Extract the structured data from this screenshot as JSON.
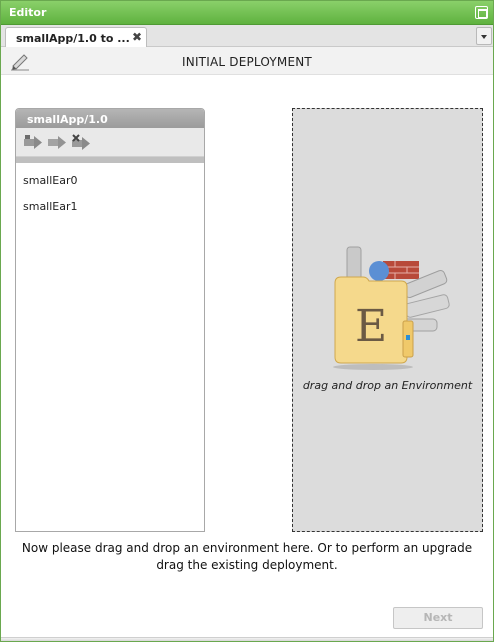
{
  "window": {
    "title": "Editor"
  },
  "tabs": [
    {
      "label": "smallApp/1.0 to ...",
      "close": "✖"
    }
  ],
  "header": {
    "title": "INITIAL DEPLOYMENT",
    "icon": "pencil-icon"
  },
  "app_panel": {
    "title": "smallApp/1.0",
    "toolbar_icons": [
      "deploy-arrow-icon",
      "move-arrow-icon",
      "remove-arrow-icon"
    ],
    "items": [
      {
        "label": "smallEar0"
      },
      {
        "label": "smallEar1"
      }
    ]
  },
  "dropzone": {
    "hint": "drag and drop an Environment",
    "icon": "environment-icon",
    "icon_letter": "E"
  },
  "instruction": "Now please drag and drop an environment here. Or to perform an upgrade drag the existing deployment.",
  "footer": {
    "next_label": "Next",
    "next_enabled": false
  },
  "colors": {
    "titlebar": "#6cbf4a",
    "panel_header": "#a8a8a8",
    "dropzone_bg": "#dcdcdc"
  }
}
